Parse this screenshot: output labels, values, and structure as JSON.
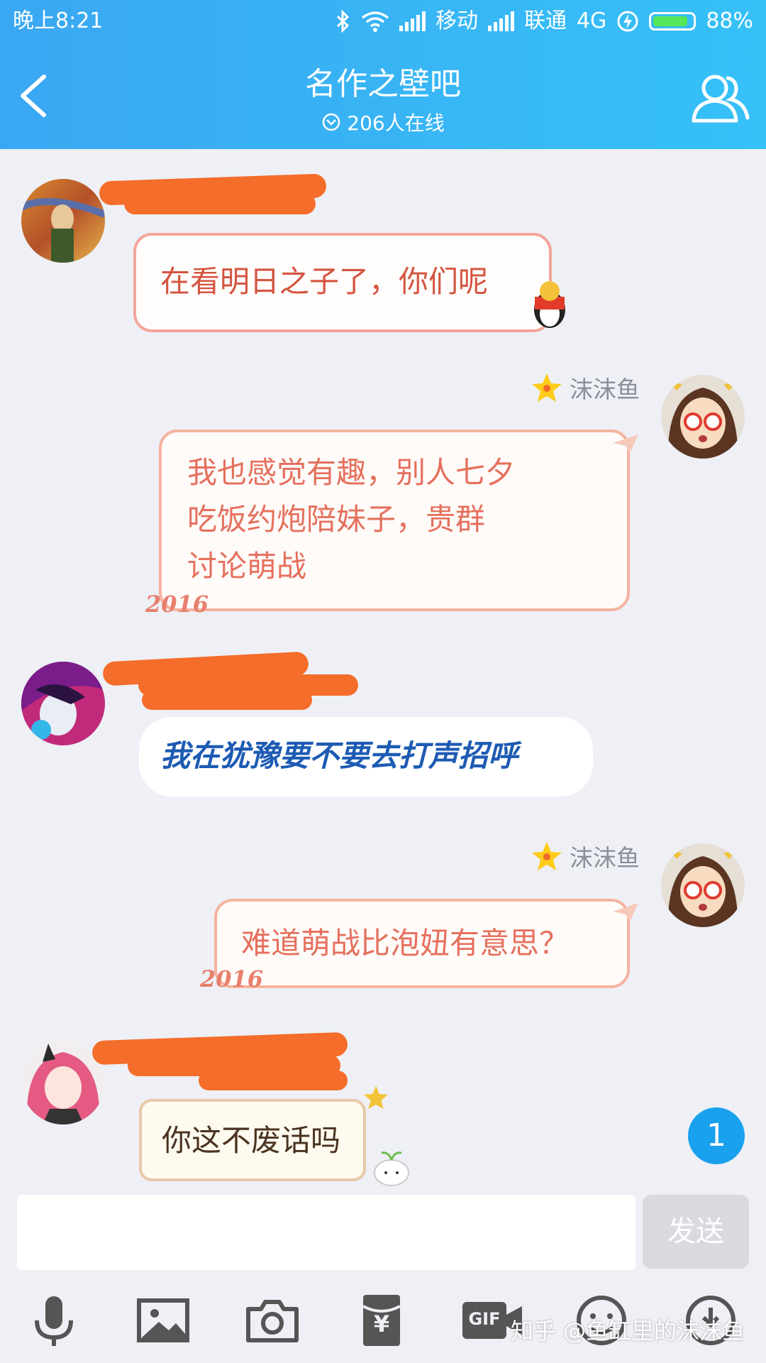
{
  "status_bar": {
    "time": "晚上8:21",
    "carrier1": "移动",
    "carrier2": "联通",
    "network": "4G",
    "battery": "88%",
    "battery_level": 0.88
  },
  "header": {
    "title": "名作之壁吧",
    "online": "206人在线",
    "back_icon": "chevron-left-icon",
    "group_icon": "group-members-icon"
  },
  "messages": [
    {
      "side": "left",
      "nick_redacted": true,
      "text": "在看明日之子了，你们呢"
    },
    {
      "side": "right",
      "nick": "沫沫鱼",
      "lines": [
        "我也感觉有趣，别人七夕",
        "吃饭约炮陪妹子，贵群",
        "讨论萌战"
      ]
    },
    {
      "side": "left",
      "nick_redacted": true,
      "text": "我在犹豫要不要去打声招呼"
    },
    {
      "side": "right",
      "nick": "沫沫鱼",
      "text": "难道萌战比泡妞有意思？"
    },
    {
      "side": "left",
      "nick_redacted": true,
      "text": "你这不废话吗"
    }
  ],
  "decorations": {
    "year_stamp": "2016"
  },
  "unread_badge": "1",
  "input": {
    "value": "",
    "send_label": "发送"
  },
  "toolbar": {
    "icons": [
      "microphone-icon",
      "image-icon",
      "camera-icon",
      "red-packet-icon",
      "gif-icon",
      "emoji-icon",
      "more-icon"
    ],
    "gif_label": "GIF",
    "yuan_label": "¥"
  },
  "watermark": "知乎 @鱼缸里的沫沫鱼",
  "colors": {
    "header": "#36b4f5",
    "accent": "#1aa1ee",
    "redaction": "#f46d2a"
  }
}
